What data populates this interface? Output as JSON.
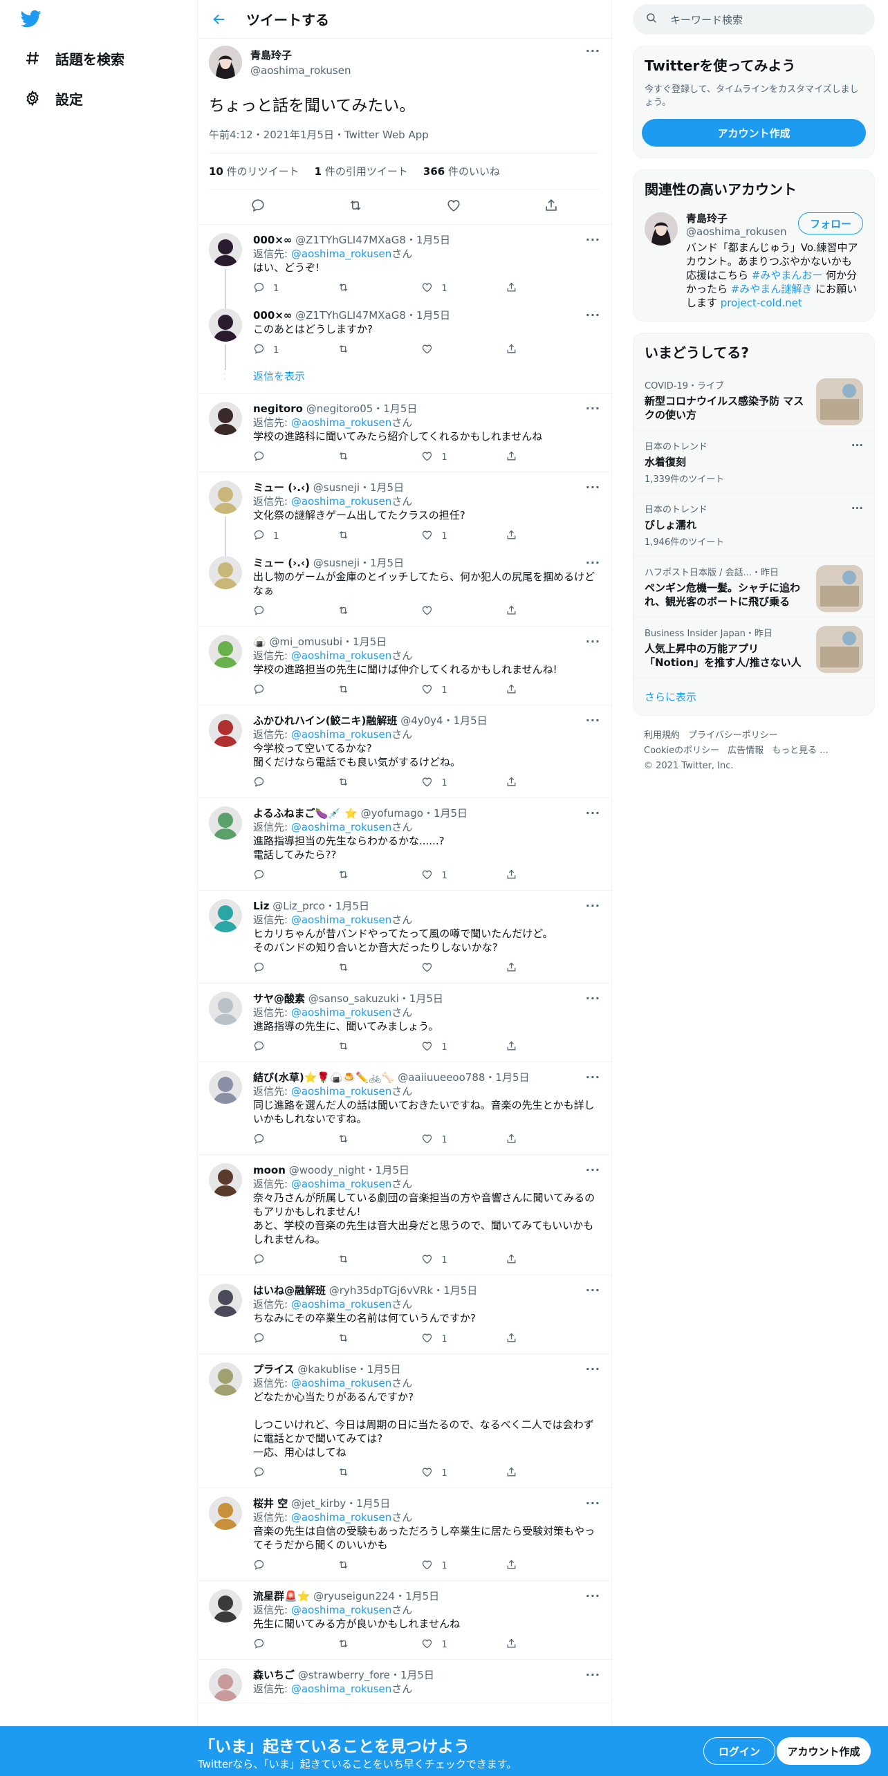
{
  "nav": {
    "explore_label": "話題を検索",
    "settings_label": "設定"
  },
  "header": {
    "title": "ツイートする"
  },
  "main_tweet": {
    "name": "青島玲子",
    "handle": "@aoshima_rokusen",
    "text": "ちょっと話を聞いてみたい。",
    "meta": "午前4:12・2021年1月5日・Twitter Web App",
    "retweets_count": "10",
    "retweets_label": "件のリツイート",
    "quotes_count": "1",
    "quotes_label": "件の引用ツイート",
    "likes_count": "366",
    "likes_label": "件のいいね"
  },
  "reply_to_label": "返信先: ",
  "reply_to_handle": "@aoshima_rokusen",
  "reply_to_suffix": "さん",
  "show_replies_label": "返信を表示",
  "replies": [
    {
      "name": "000×∞",
      "meta": "@Z1TYhGLI47MXaG8・1月5日",
      "reply_to": true,
      "text": "はい、どうぞ!",
      "reply_count": "1",
      "like_count": "1",
      "threaded": true,
      "avatar_color": "#2b1b2e"
    },
    {
      "name": "000×∞",
      "meta": "@Z1TYhGLI47MXaG8・1月5日",
      "reply_to": false,
      "text": "このあとはどうしますか?",
      "reply_count": "1",
      "like_count": "",
      "threaded": false,
      "show_replies": true,
      "avatar_color": "#2b1b2e"
    },
    {
      "name": "negitoro",
      "meta": "@negitoro05・1月5日",
      "reply_to": true,
      "text": "学校の進路科に聞いてみたら紹介してくれるかもしれませんね",
      "reply_count": "",
      "like_count": "1",
      "threaded": false,
      "avatar_color": "#3a2a2a"
    },
    {
      "name": "ミュー (›.‹)",
      "meta": "@susneji・1月5日",
      "reply_to": true,
      "text": "文化祭の謎解きゲーム出してたクラスの担任?",
      "reply_count": "1",
      "like_count": "1",
      "threaded": true,
      "avatar_color": "#c9b77a"
    },
    {
      "name": "ミュー (›.‹)",
      "meta": "@susneji・1月5日",
      "reply_to": false,
      "text": "出し物のゲームが金庫のとイッチしてたら、何か犯人の尻尾を掴めるけどなぁ",
      "reply_count": "",
      "like_count": "",
      "threaded": false,
      "avatar_color": "#c9b77a"
    },
    {
      "name": "🍙",
      "meta": "@mi_omusubi・1月5日",
      "reply_to": true,
      "text": "学校の進路担当の先生に聞けば仲介してくれるかもしれませんね!",
      "reply_count": "",
      "like_count": "1",
      "threaded": false,
      "avatar_color": "#6ab04c"
    },
    {
      "name": "ふかひれハイン(鮫ニキ)融解班",
      "meta": "@4y0y4・1月5日",
      "reply_to": true,
      "text": "今学校って空いてるかな?\n聞くだけなら電話でも良い気がするけどね。",
      "reply_count": "",
      "like_count": "1",
      "threaded": false,
      "avatar_color": "#b03030"
    },
    {
      "name": "よるふねまご🍆💉 ⭐",
      "meta": "@yofumago・1月5日",
      "reply_to": true,
      "text": "進路指導担当の先生ならわかるかな......?\n電話してみたら??",
      "reply_count": "",
      "like_count": "1",
      "threaded": false,
      "avatar_color": "#5aa06a"
    },
    {
      "name": "Liz",
      "meta": "@Liz_prco・1月5日",
      "reply_to": true,
      "text": "ヒカリちゃんが昔バンドやってたって風の噂で聞いたんだけど。\nそのバンドの知り合いとか音大だったりしないかな?",
      "reply_count": "",
      "like_count": "",
      "threaded": false,
      "avatar_color": "#2aa6a6"
    },
    {
      "name": "サヤ@酸素",
      "meta": "@sanso_sakuzuki・1月5日",
      "reply_to": true,
      "text": "進路指導の先生に、聞いてみましょう。",
      "reply_count": "",
      "like_count": "1",
      "threaded": false,
      "avatar_color": "#b9c1c9"
    },
    {
      "name": "結び(水草)⭐🌹🍙🍮✏️🚲🦴",
      "meta": "@aaiiuueeoo788・1月5日",
      "reply_to": true,
      "text": "同じ進路を選んだ人の話は聞いておきたいですね。音楽の先生とかも詳しいかもしれないですね。",
      "reply_count": "",
      "like_count": "1",
      "threaded": false,
      "avatar_color": "#8a8fa6"
    },
    {
      "name": "moon",
      "meta": "@woody_night・1月5日",
      "reply_to": true,
      "text": "奈々乃さんが所属している劇団の音楽担当の方や音響さんに聞いてみるのもアリかもしれません!\nあと、学校の音楽の先生は音大出身だと思うので、聞いてみてもいいかもしれませんね。",
      "reply_count": "",
      "like_count": "1",
      "threaded": false,
      "avatar_color": "#5a3a2a"
    },
    {
      "name": "はいね@融解班",
      "meta": "@ryh35dpTGj6vVRk・1月5日",
      "reply_to": true,
      "text": "ちなみにその卒業生の名前は何ていうんですか?",
      "reply_count": "",
      "like_count": "1",
      "threaded": false,
      "avatar_color": "#4a4a5a"
    },
    {
      "name": "プライス",
      "meta": "@kakublise・1月5日",
      "reply_to": true,
      "text": "どなたか心当たりがあるんですか?\n\nしつこいけれど、今日は周期の日に当たるので、なるべく二人では会わずに電話とかで聞いてみては?\n一応、用心はしてね",
      "reply_count": "",
      "like_count": "1",
      "threaded": false,
      "avatar_color": "#a0a070"
    },
    {
      "name": "桜井 空",
      "meta": "@jet_kirby・1月5日",
      "reply_to": true,
      "text": "音楽の先生は自信の受験もあっただろうし卒業生に居たら受験対策もやってそうだから聞くのいいかも",
      "reply_count": "",
      "like_count": "1",
      "threaded": false,
      "avatar_color": "#c8903a"
    },
    {
      "name": "流星群🚨⭐",
      "meta": "@ryuseigun224・1月5日",
      "reply_to": true,
      "text": "先生に聞いてみる方が良いかもしれませんね",
      "reply_count": "",
      "like_count": "1",
      "threaded": false,
      "avatar_color": "#3a3a3a"
    },
    {
      "name": "森いちご",
      "meta": "@strawberry_fore・1月5日",
      "reply_to": true,
      "text": "",
      "reply_count": "",
      "like_count": "",
      "threaded": false,
      "avatar_color": "#c89a9a"
    }
  ],
  "search": {
    "placeholder": "キーワード検索"
  },
  "signup_card": {
    "title": "Twitterを使ってみよう",
    "desc": "今すぐ登録して、タイムラインをカスタマイズしましょう。",
    "button": "アカウント作成"
  },
  "related": {
    "title": "関連性の高いアカウント",
    "name": "青島玲子",
    "handle": "@aoshima_rokusen",
    "follow_label": "フォロー",
    "bio_1": "バンド「都まんじゅう」Vo.練習中アカウント。あまりつぶやかないかも 応援はこちら ",
    "bio_tag1": "#みやまんおー",
    "bio_2": " 何か分かったら ",
    "bio_tag2": "#みやまん謎解き",
    "bio_3": " にお願いします ",
    "bio_link": "project-cold.net"
  },
  "trends": {
    "title": "いまどうしてる?",
    "items": [
      {
        "context": "COVID-19・ライブ",
        "title": "新型コロナウイルス感染予防 マスクの使い方",
        "count": "",
        "kind": "thumb"
      },
      {
        "context": "日本のトレンド",
        "title": "水着復刻",
        "count": "1,339件のツイート",
        "kind": "more"
      },
      {
        "context": "日本のトレンド",
        "title": "びしょ濡れ",
        "count": "1,946件のツイート",
        "kind": "more"
      },
      {
        "context": "ハフポスト日本版 / 会話...・昨日",
        "title": "ペンギン危機一髪。シャチに追われ、観光客のボートに飛び乗る",
        "count": "",
        "kind": "thumb"
      },
      {
        "context": "Business Insider Japan・昨日",
        "title": "人気上昇中の万能アプリ「Notion」を推す人/推さない人",
        "count": "",
        "kind": "thumb"
      }
    ],
    "show_more": "さらに表示"
  },
  "footer": {
    "links_1": [
      "利用規約",
      "プライバシーポリシー"
    ],
    "links_2": [
      "Cookieのポリシー",
      "広告情報",
      "もっと見る ..."
    ],
    "copyright": "© 2021 Twitter, Inc."
  },
  "bottom_bar": {
    "title": "「いま」起きていることを見つけよう",
    "subtitle": "Twitterなら、「いま」起きていることをいち早くチェックできます。",
    "login": "ログイン",
    "signup": "アカウント作成"
  },
  "colors": {
    "accent": "#1d9bf0",
    "text": "#0f1419",
    "muted": "#536471",
    "border": "#eff3f4"
  },
  "icons": [
    "twitter-logo-icon",
    "hashtag-icon",
    "gear-icon",
    "back-arrow-icon",
    "more-icon",
    "reply-icon",
    "retweet-icon",
    "like-icon",
    "share-icon",
    "search-icon",
    "verified-icon"
  ]
}
